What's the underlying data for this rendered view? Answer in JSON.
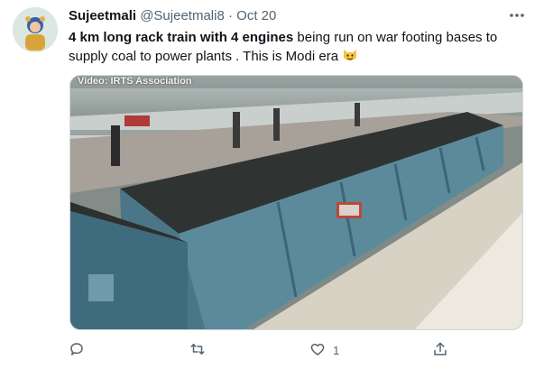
{
  "tweet": {
    "author_name": "Sujeetmali",
    "author_handle": "@Sujeetmali8",
    "separator": "·",
    "date": "Oct 20",
    "text_bold": "4 km long rack train with 4 engines",
    "text_rest": " being run on war footing bases to supply coal to power plants  .  This is Modi era ",
    "emoji": "cat-face-emoji"
  },
  "media": {
    "watermark": "Video: IRTS Association"
  },
  "actions": {
    "reply_icon": "reply-icon",
    "retweet_icon": "retweet-icon",
    "like_icon": "heart-icon",
    "like_count": "1",
    "share_icon": "share-icon"
  }
}
